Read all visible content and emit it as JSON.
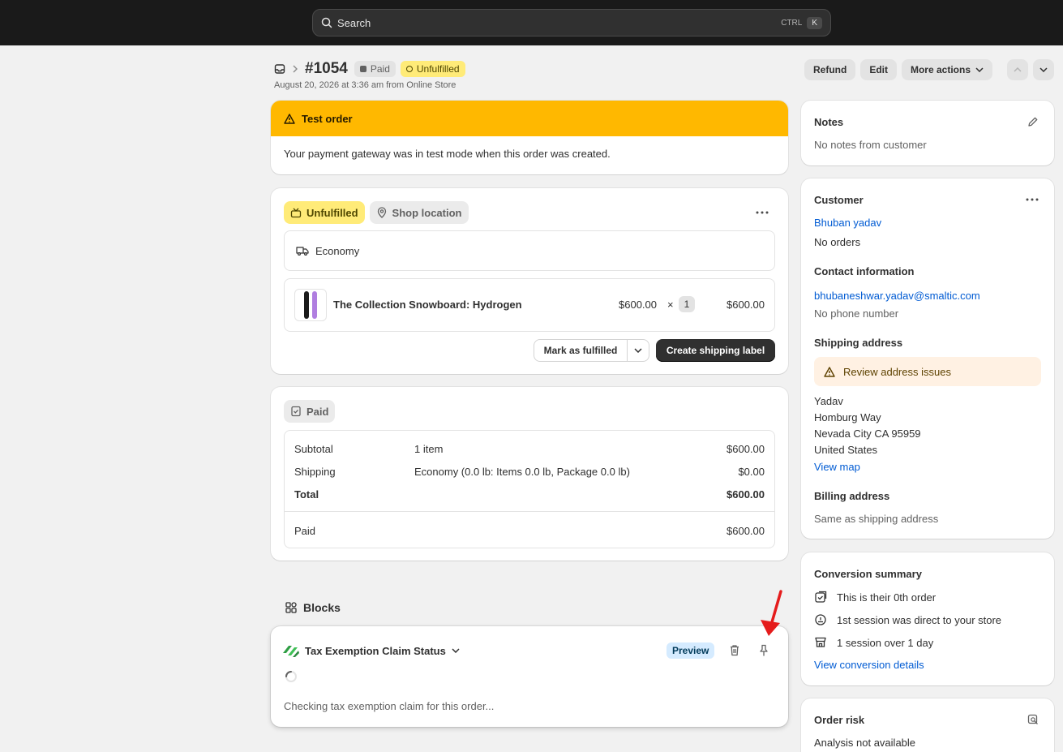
{
  "search": {
    "placeholder": "Search",
    "shortcut_mod": "CTRL",
    "shortcut_key": "K"
  },
  "header": {
    "order_number": "#1054",
    "paid_badge": "Paid",
    "unfulfilled_badge": "Unfulfilled",
    "subtitle": "August 20, 2026 at 3:36 am from Online Store",
    "refund_label": "Refund",
    "edit_label": "Edit",
    "more_actions_label": "More actions"
  },
  "test_order": {
    "title": "Test order",
    "message": "Your payment gateway was in test mode when this order was created."
  },
  "fulfillment": {
    "status_badge": "Unfulfilled",
    "location_badge": "Shop location",
    "shipping_method": "Economy",
    "item": {
      "name": "The Collection Snowboard: Hydrogen",
      "price": "$600.00",
      "times": "×",
      "quantity": "1",
      "total": "$600.00"
    },
    "mark_fulfilled_label": "Mark as fulfilled",
    "create_label_label": "Create shipping label"
  },
  "payment": {
    "status_badge": "Paid",
    "rows": [
      {
        "label": "Subtotal",
        "detail": "1 item",
        "amount": "$600.00"
      },
      {
        "label": "Shipping",
        "detail": "Economy (0.0 lb: Items 0.0 lb, Package 0.0 lb)",
        "amount": "$0.00"
      },
      {
        "label": "Total",
        "detail": "",
        "amount": "$600.00"
      }
    ],
    "paid_label": "Paid",
    "paid_amount": "$600.00"
  },
  "blocks": {
    "heading": "Blocks",
    "app_title": "Tax Exemption Claim Status",
    "preview_label": "Preview",
    "loading_text": "Checking tax exemption claim for this order..."
  },
  "notes": {
    "title": "Notes",
    "text": "No notes from customer"
  },
  "customer": {
    "title": "Customer",
    "name": "Bhuban yadav",
    "orders": "No orders",
    "contact_title": "Contact information",
    "email": "bhubaneshwar.yadav@smaltic.com",
    "phone": "No phone number",
    "shipping_title": "Shipping address",
    "address_warning": "Review address issues",
    "address_lines": [
      "Yadav",
      "Homburg Way",
      "Nevada City CA 95959",
      "United States"
    ],
    "view_map": "View map",
    "billing_title": "Billing address",
    "billing_text": "Same as shipping address"
  },
  "conversion": {
    "title": "Conversion summary",
    "items": [
      "This is their 0th order",
      "1st session was direct to your store",
      "1 session over 1 day"
    ],
    "link": "View conversion details"
  },
  "risk": {
    "title": "Order risk",
    "text": "Analysis not available"
  },
  "colors": {
    "warning_banner": "#ffb800",
    "unfulfilled_badge": "#ffeb78",
    "link": "#005bd3",
    "annotation_arrow": "#e51c1c"
  }
}
